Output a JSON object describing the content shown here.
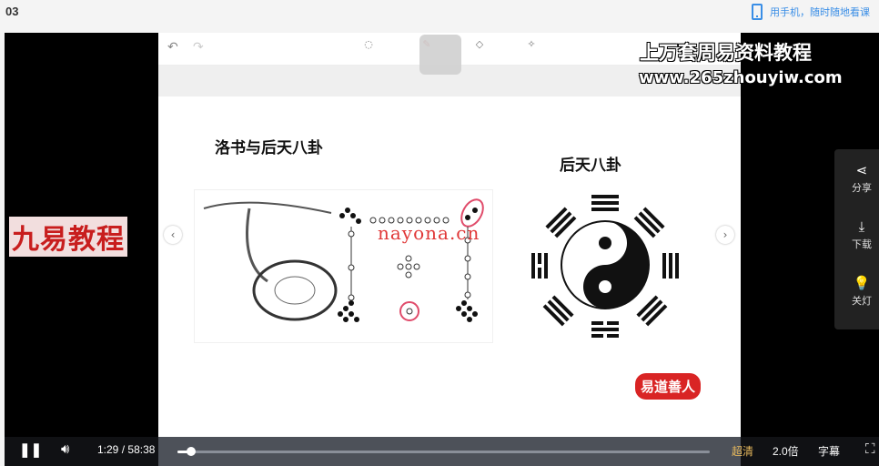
{
  "header": {
    "episode": "03",
    "mobile_text": "用手机，随时随地看课"
  },
  "slide": {
    "title_left": "洛书与后天八卦",
    "title_right": "后天八卦",
    "watermark": "nayona.cn",
    "stamp": "易道善人"
  },
  "overlay": {
    "logo_left": "九易教程",
    "line1": "上万套周易资料教程",
    "line2": "www.265zhouyiw.com"
  },
  "side_menu": [
    {
      "icon": "share-icon",
      "label": "分享"
    },
    {
      "icon": "download-icon",
      "label": "下载"
    },
    {
      "icon": "lightbulb-icon",
      "label": "关灯"
    }
  ],
  "controls": {
    "current_time": "1:29",
    "separator": "/",
    "duration": "58:38",
    "progress": 0.025,
    "quality": "超清",
    "speed": "2.0倍",
    "subtitle": "字幕",
    "quality_color": "#e6b85c"
  }
}
